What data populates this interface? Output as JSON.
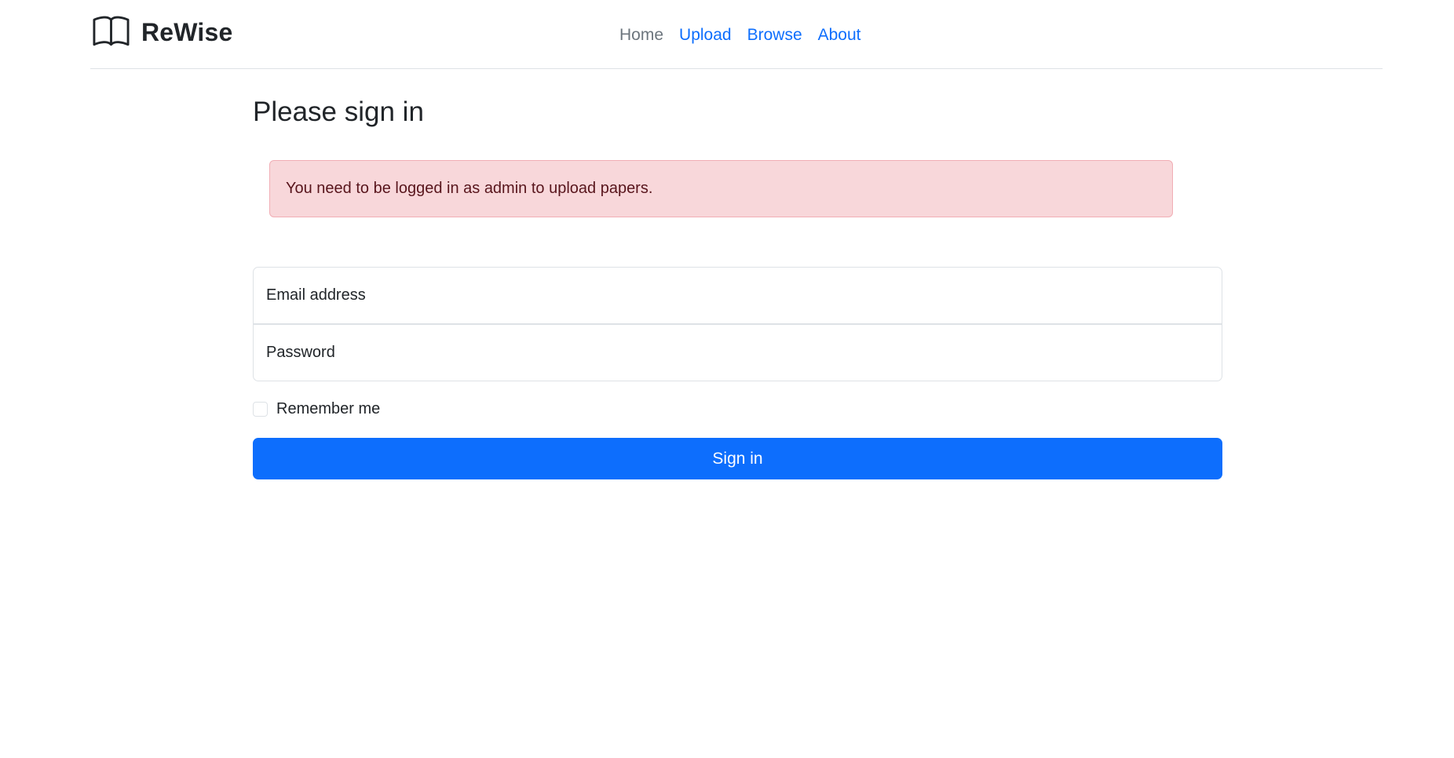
{
  "brand": {
    "name": "ReWise",
    "icon": "book-open-icon"
  },
  "nav": {
    "items": [
      {
        "label": "Home",
        "active": true
      },
      {
        "label": "Upload",
        "active": false
      },
      {
        "label": "Browse",
        "active": false
      },
      {
        "label": "About",
        "active": false
      }
    ]
  },
  "page": {
    "title": "Please sign in"
  },
  "alert": {
    "message": "You need to be logged in as admin to upload papers.",
    "variant": "danger",
    "background": "#f8d7da",
    "text_color": "#58151c"
  },
  "form": {
    "email_placeholder": "Email address",
    "email_value": "",
    "password_placeholder": "Password",
    "password_value": "",
    "remember_label": "Remember me",
    "remember_checked": false,
    "submit_label": "Sign in"
  },
  "colors": {
    "primary": "#0d6efd",
    "nav_active": "#6c757d",
    "text": "#212529"
  }
}
